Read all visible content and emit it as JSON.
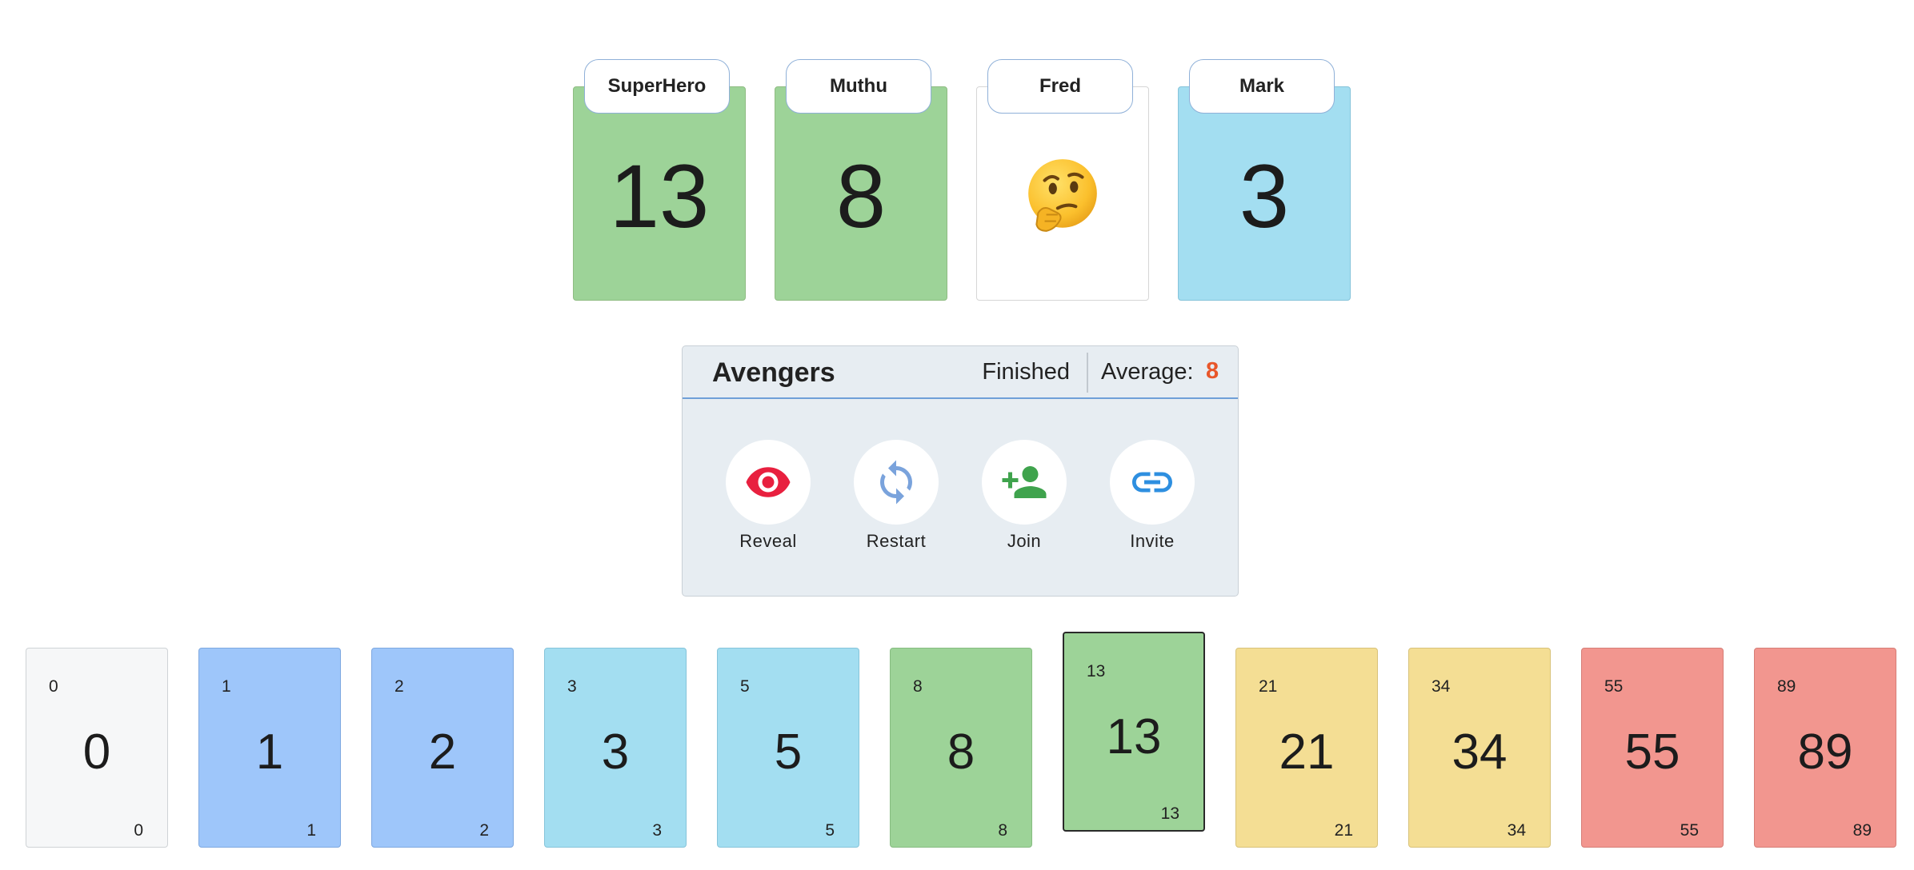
{
  "players": [
    {
      "name": "SuperHero",
      "value": "13",
      "color": "#9dd398"
    },
    {
      "name": "Muthu",
      "value": "8",
      "color": "#9dd398"
    },
    {
      "name": "Fred",
      "value": "",
      "status_icon": "thinking-face-emoji"
    },
    {
      "name": "Mark",
      "value": "3",
      "color": "#a3def1"
    }
  ],
  "game": {
    "name": "Avengers",
    "status": "Finished",
    "average_label": "Average:",
    "average_value": "8",
    "accent_color": "#e8562a"
  },
  "actions": [
    {
      "label": "Reveal",
      "icon": "eye-icon",
      "color": "#e8203f"
    },
    {
      "label": "Restart",
      "icon": "refresh-icon",
      "color": "#7aa3dc"
    },
    {
      "label": "Join",
      "icon": "add-person-icon",
      "color": "#3fa34d"
    },
    {
      "label": "Invite",
      "icon": "link-icon",
      "color": "#2e8fe0"
    }
  ],
  "deck": [
    {
      "value": "0",
      "color": "#f6f7f8"
    },
    {
      "value": "1",
      "color": "#9ec6fa"
    },
    {
      "value": "2",
      "color": "#9ec6fa"
    },
    {
      "value": "3",
      "color": "#a3def1"
    },
    {
      "value": "5",
      "color": "#a3def1"
    },
    {
      "value": "8",
      "color": "#9dd398"
    },
    {
      "value": "13",
      "color": "#9dd398",
      "selected": true
    },
    {
      "value": "21",
      "color": "#f4de94"
    },
    {
      "value": "34",
      "color": "#f4de94"
    },
    {
      "value": "55",
      "color": "#f2968f"
    },
    {
      "value": "89",
      "color": "#f2968f"
    }
  ]
}
